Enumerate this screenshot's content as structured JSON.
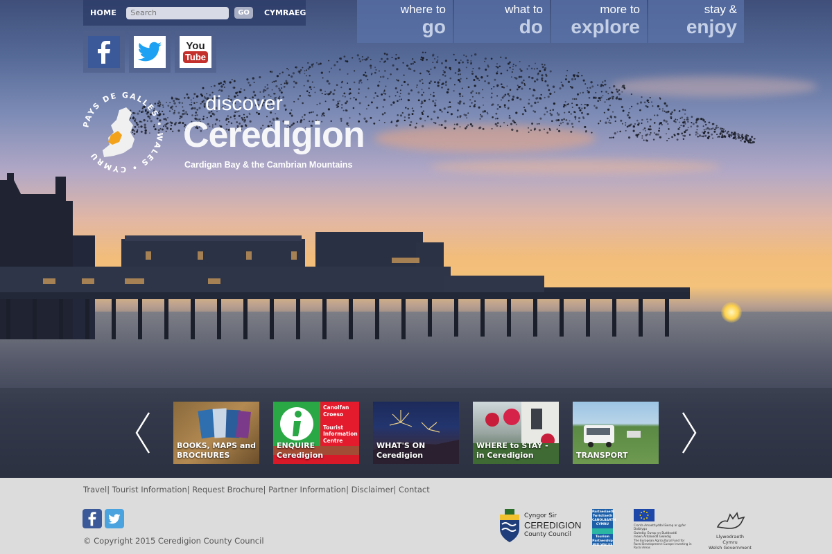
{
  "topbar": {
    "home_label": "HOME",
    "search_placeholder": "Search",
    "go_label": "GO",
    "language_label": "CYMRAEG"
  },
  "social": [
    "facebook-icon",
    "twitter-icon",
    "youtube-icon"
  ],
  "social_labels": {
    "youtube_top": "You",
    "youtube_bottom": "Tube"
  },
  "mainnav": [
    {
      "small": "where to",
      "big": "go"
    },
    {
      "small": "what to",
      "big": "do"
    },
    {
      "small": "more to",
      "big": "explore"
    },
    {
      "small": "stay &",
      "big": "enjoy"
    }
  ],
  "logo": {
    "discover": "discover",
    "brand": "Ceredigion",
    "tagline": "Cardigan Bay & the Cambrian Mountains",
    "emblem_text": "PAYS DE GALLES • WALES • CYMRU"
  },
  "carousel": [
    {
      "label1": "BOOKS, MAPS and",
      "label2": "BROCHURES"
    },
    {
      "label1": "ENQUIRE",
      "label2": "Ceredigion",
      "sign_lines": [
        "Canolfan",
        "Croeso",
        "Tourist",
        "Information",
        "Centre"
      ]
    },
    {
      "label1": "WHAT'S ON",
      "label2": "Ceredigion"
    },
    {
      "label1": "WHERE to STAY -",
      "label2": "in Ceredigion"
    },
    {
      "label1": "TRANSPORT",
      "label2": ""
    }
  ],
  "footer": {
    "links": [
      "Travel",
      "Tourist Information",
      "Request Brochure",
      "Partner Information",
      "Disclaimer",
      "Contact"
    ],
    "copyright": "© Copyright 2015 Ceredigion County Council",
    "council_line1": "Cyngor Sir",
    "council_line2": "CEREDIGION",
    "council_line3": "County Council",
    "partnership_lines": [
      "Partneriaeth",
      "Twristiaeth",
      "CANOLBARTH",
      "CYMRU",
      "Tourism",
      "Partnership",
      "MID WALES"
    ],
    "eu_text_lines": [
      "Cronfa Amaethyddol Ewrop ar gyfer Datblygu",
      "Gwledig: Ewrop yn Buddsoddi",
      "mewn Ardaloedd Gwledig",
      "The European Agricultural Fund for",
      "Rural Development: Europe Investing in",
      "Rural Areas"
    ],
    "welsh_gov_line1": "Llywodraeth Cymru",
    "welsh_gov_line2": "Welsh Government"
  },
  "colors": {
    "nav_bg": "#5a73aa",
    "topbar_bg": "#283764",
    "footer_bg": "#dcdcdc",
    "tic_red": "#e41b2c",
    "tic_green": "#2aa845",
    "facebook_blue": "#3b5998",
    "twitter_blue": "#1da1f2",
    "youtube_red": "#c4302b"
  }
}
